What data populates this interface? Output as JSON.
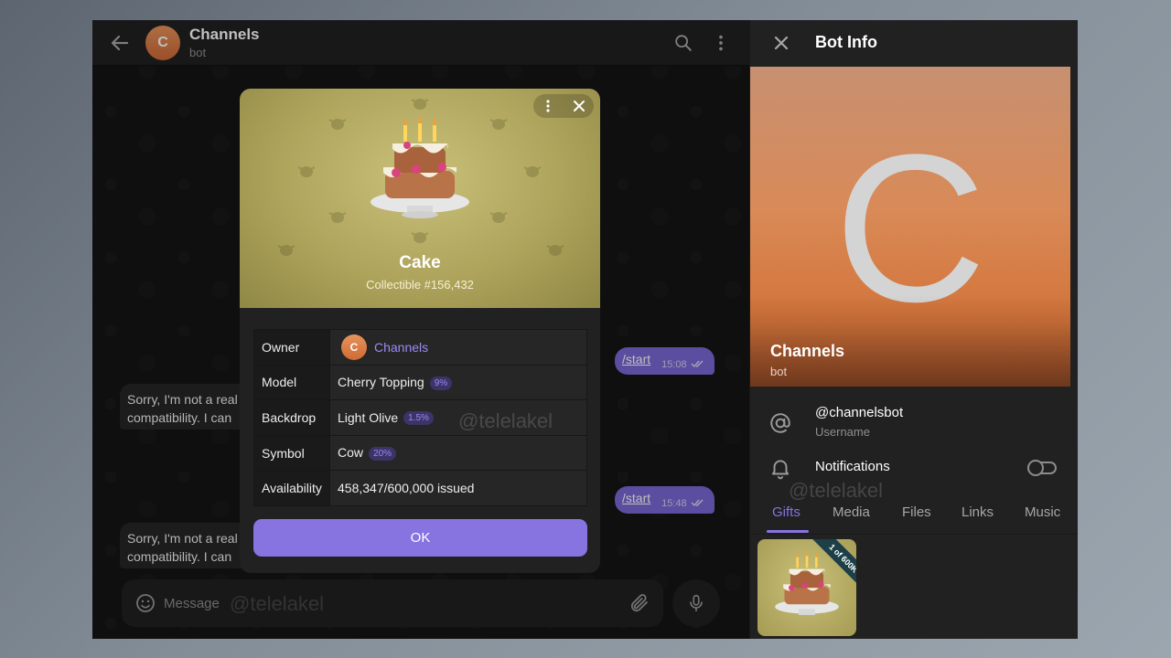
{
  "chat": {
    "title": "Channels",
    "subtitle": "bot",
    "avatar_letter": "C",
    "messages": [
      {
        "text": "/start",
        "time": "15:08"
      },
      {
        "text": "/start",
        "time": "15:48"
      }
    ],
    "incoming": [
      {
        "line1": "Sorry, I'm not a real",
        "line2": "compatibility. I can"
      },
      {
        "line1": "Sorry, I'm not a real",
        "line2": "compatibility. I can"
      }
    ],
    "composer_placeholder": "Message",
    "watermark": "@telelakel"
  },
  "gift_modal": {
    "name": "Cake",
    "collectible": "Collectible #156,432",
    "rows": [
      {
        "key": "Owner",
        "value": "Channels",
        "avatar_letter": "C"
      },
      {
        "key": "Model",
        "value": "Cherry Topping",
        "badge": "9%"
      },
      {
        "key": "Backdrop",
        "value": "Light Olive",
        "badge": "1.5%"
      },
      {
        "key": "Symbol",
        "value": "Cow",
        "badge": "20%"
      },
      {
        "key": "Availability",
        "value": "458,347/600,000 issued"
      }
    ],
    "ok_label": "OK",
    "backdrop_color": "#b1a862"
  },
  "panel": {
    "title": "Bot Info",
    "profile_letter": "C",
    "profile_name": "Channels",
    "profile_sub": "bot",
    "username": "@channelsbot",
    "username_label": "Username",
    "notifications_label": "Notifications",
    "notifications_on": false,
    "tabs": [
      "Gifts",
      "Media",
      "Files",
      "Links",
      "Music"
    ],
    "active_tab": "Gifts",
    "gift_badge": "1 of 600K",
    "watermark": "@telelakel"
  },
  "colors": {
    "accent": "#8774e1",
    "outgoing_bubble": "#7a67d4",
    "profile_orange": "#d3733a"
  }
}
